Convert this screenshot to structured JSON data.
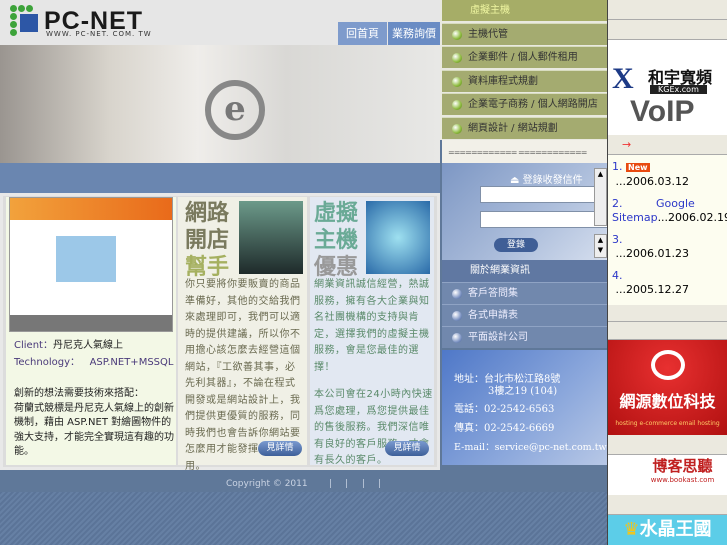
{
  "header": {
    "logo": "PC-NET",
    "logo_url": "WWW. PC-NET. COM. TW",
    "tabs": [
      "回首頁",
      "業務詢價"
    ]
  },
  "showcase": {
    "client_label": "Client：",
    "client": "丹尼克人氣線上",
    "tech_label": "Technology：",
    "tech": "ASP.NET+MSSQL",
    "desc_title": "創新的想法需要技術來搭配：",
    "desc": "荷蘭式競標是丹尼克人氣線上的創新機制，藉由 ASP.NET 對繪圖物件的強大支持，才能完全實現這有趣的功能。"
  },
  "promo1": {
    "title": [
      "網路",
      "開店",
      "幫手"
    ],
    "text": "你只要將你要販賣的商品準備好，其他的交給我們來處理即可，我們可以適時的提供建議，所以你不用擔心該怎麼去經營這個網站，『工欲善其事，必先利其器』，不論在程式開發或是網站設計上，我們提供更優質的服務，同時我們也會告訴你網站要怎麼用才能發揮最大的效用。",
    "more": "見詳情"
  },
  "promo2": {
    "title": [
      "虛擬",
      "主機",
      "優惠"
    ],
    "text1": "網業資訊誠信經營，熱誠服務，擁有各大企業與知名社團機構的支持與肯定，選擇我們的虛擬主機服務，會是您最佳的選擇！",
    "text2": "本公司會在24小時內快速爲您處理，爲您提供最佳的售後服務。我們深信唯有良好的客戶服務，才會有長久的客戶。",
    "more": "見詳情"
  },
  "menu": {
    "header": "虛擬主機",
    "items": [
      "主機代管",
      "企業郵件 / 個人郵件租用",
      "資料庫程式規劃",
      "企業電子商務 / 個人網路開店",
      "網頁設計 / 網站規劃"
    ],
    "dashes": "============  ============"
  },
  "login": {
    "title": "登錄收發信件",
    "button": "登錄",
    "scroll_up": "▲",
    "scroll_down": "▼"
  },
  "about": {
    "header": "關於網業資訊",
    "items": [
      "客戶答問集",
      "各式申請表",
      "平面設計公司"
    ]
  },
  "contact": {
    "address": "地址：台北市松江路8號",
    "address2": "3樓之19 (104)",
    "phone": "電話：02-2542-6563",
    "fax": "傳真：02-2542-6669",
    "email": "E-mail：service@pc-net.com.tw"
  },
  "footer": {
    "copyright": "Copyright © 2011",
    "separator": "|"
  },
  "ads": {
    "voip_brand": "和宇寬頻",
    "voip_url": "KGEx.com",
    "voip": "VoIP",
    "arrow": "→",
    "red_brand": "網源數位科技",
    "red_tags": "hosting  e-commerce  email hosting",
    "bookast": "博客思聽",
    "bookast_url": "www.bookast.com",
    "crystal": "水晶王國"
  },
  "news": [
    {
      "num": "1.",
      "badge": "New",
      "date": "...2006.03.12"
    },
    {
      "num": "2.",
      "title": "Google Sitemap",
      "date": "...2006.02.19"
    },
    {
      "num": "3.",
      "date": "...2006.01.23"
    },
    {
      "num": "4.",
      "date": "...2005.12.27"
    }
  ]
}
